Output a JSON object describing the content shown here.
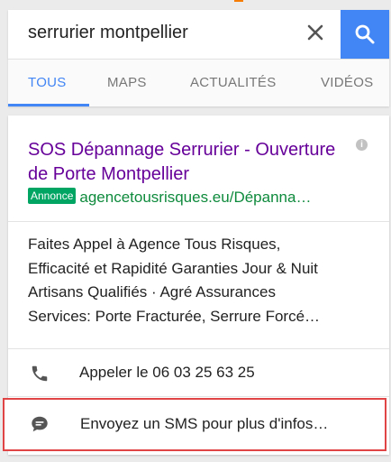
{
  "search": {
    "query": "serrurier montpellier",
    "clear_icon": "close-icon",
    "search_icon": "search-icon",
    "accent_color": "#4285f4"
  },
  "tabs": [
    {
      "label": "TOUS",
      "active": true
    },
    {
      "label": "MAPS",
      "active": false
    },
    {
      "label": "ACTUALITÉS",
      "active": false
    },
    {
      "label": "VIDÉOS",
      "active": false
    }
  ],
  "ad": {
    "title": "SOS Dépannage Serrurier - Ouverture de Porte Montpellier",
    "badge": "Annonce",
    "url": "agencetousrisques.eu/Dépanna…",
    "info_icon": "info-icon",
    "description": [
      "Faites Appel à Agence Tous Risques,",
      "Efficacité et Rapidité Garanties Jour & Nuit",
      "Artisans Qualifiés · Agré Assurances",
      "Services: Porte Fracturée, Serrure Forcé…"
    ],
    "call_label": "Appeler le 06 03 25 63 25",
    "call_icon": "phone-icon",
    "sms_label": "Envoyez un SMS pour plus d'infos…",
    "sms_icon": "message-icon",
    "title_color": "#660099",
    "url_color": "#0e8a3c",
    "badge_color": "#00a563",
    "highlight_color": "#e14444"
  }
}
